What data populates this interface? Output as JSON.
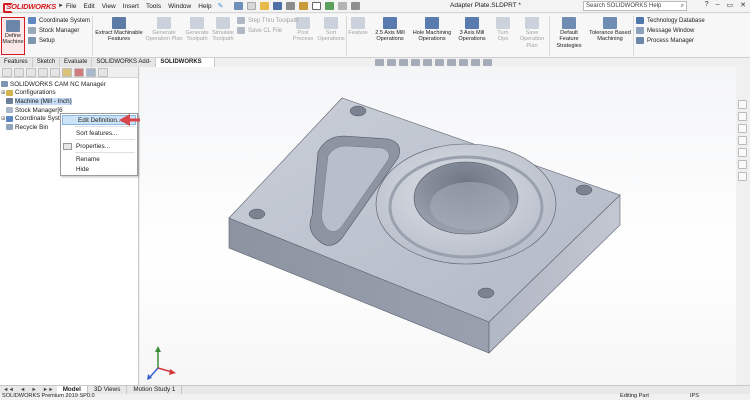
{
  "app": {
    "brand": "SOLIDWORKS",
    "menus": [
      "File",
      "Edit",
      "View",
      "Insert",
      "Tools",
      "Window",
      "Help"
    ],
    "document_title": "Adapter Plate.SLDPRT *",
    "search_placeholder": "Search SOLIDWORKS Help",
    "window_controls": [
      "?",
      "–",
      "▭",
      "✕"
    ]
  },
  "command_manager": {
    "define_machine": "Define Machine",
    "coordinate_system": "Coordinate System",
    "stock_manager": "Stock Manager",
    "setup": "Setup",
    "extract_features": "Extract Machinable Features",
    "generate_plan": "Generate Operation Plan",
    "generate_toolpath": "Generate Toolpath",
    "simulate_toolpath": "Simulate Toolpath",
    "step_thru": "Step Thru Toolpath",
    "save_cl": "Save CL File",
    "post_process": "Post Process",
    "sort_operations": "Sort Operations",
    "feature": "Feature",
    "mill_25": "2.5 Axis Mill Operations",
    "hole_machining": "Hole Machining Operations",
    "mill_3": "3 Axis Mill Operations",
    "turn_ops": "Turn Ops",
    "save_plan": "Save Operation Plan",
    "default_strategies": "Default Feature Strategies",
    "tolerance_based": "Tolerance Based Machining",
    "technology_database": "Technology Database",
    "message_window": "Message Window",
    "process_manager": "Process Manager"
  },
  "tabs": [
    {
      "label": "Features",
      "active": false
    },
    {
      "label": "Sketch",
      "active": false
    },
    {
      "label": "Evaluate",
      "active": false
    },
    {
      "label": "SOLIDWORKS Add-Ins",
      "active": false
    },
    {
      "label": "SOLIDWORKS CAM",
      "active": true
    }
  ],
  "tree": {
    "root": "SOLIDWORKS CAM NC Manager",
    "configurations": "Configurations",
    "machine": "Machine (Mill - Inch)",
    "stock_manager": "Stock Manager[6",
    "coordinate_system": "Coordinate Syste",
    "recycle_bin": "Recycle Bin"
  },
  "context_menu": {
    "edit_definition": "Edit Definition...",
    "sort_features": "Sort features...",
    "properties": "Properties...",
    "rename": "Rename",
    "hide": "Hide"
  },
  "bottom_tabs": {
    "model": "Model",
    "views_3d": "3D Views",
    "motion_study": "Motion Study 1"
  },
  "status": {
    "version": "SOLIDWORKS Premium 2019 SP0.0",
    "mode": "Editing Part",
    "units": "IPS"
  },
  "colors": {
    "brand_red": "#d71920",
    "selection_blue": "#c5dcf4",
    "callout_arrow": "#d9454a"
  },
  "icons": [
    "solidworks-logo",
    "pin-icon",
    "search-icon",
    "question-icon",
    "expand-icon",
    "triad-icon"
  ]
}
